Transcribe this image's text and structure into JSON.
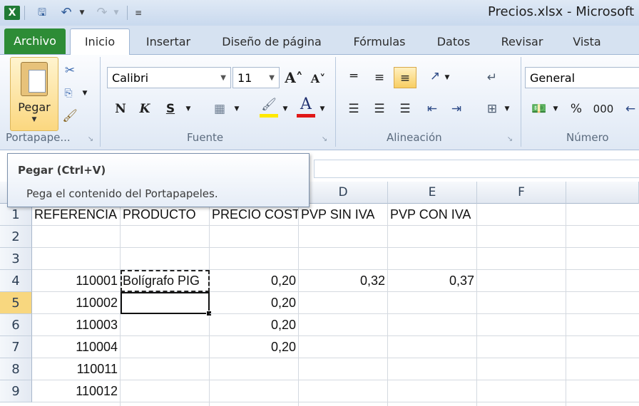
{
  "window": {
    "title": "Precios.xlsx - Microsoft E"
  },
  "tabs": [
    "Archivo",
    "Inicio",
    "Insertar",
    "Diseño de página",
    "Fórmulas",
    "Datos",
    "Revisar",
    "Vista"
  ],
  "ribbon": {
    "paste_label": "Pegar",
    "font_name": "Calibri",
    "font_size": "11",
    "bold": "N",
    "italic": "K",
    "underline": "S",
    "number_format": "General",
    "percent": "%",
    "thousands": "000",
    "groups": {
      "clipboard": "Portapape...",
      "font": "Fuente",
      "alignment": "Alineación",
      "number": "Número"
    }
  },
  "tooltip": {
    "title": "Pegar (Ctrl+V)",
    "body": "Pega el contenido del Portapapeles."
  },
  "columns": [
    "D",
    "E",
    "F"
  ],
  "rows": [
    "1",
    "2",
    "3",
    "4",
    "5",
    "6",
    "7",
    "8",
    "9"
  ],
  "cells": {
    "r1": [
      "REFERENCIA",
      "PRODUCTO",
      "PRECIO COSTE",
      "PVP SIN IVA",
      "PVP CON IVA"
    ],
    "r4": [
      "110001",
      "Bolígrafo PIG",
      "0,20",
      "0,32",
      "0,37"
    ],
    "r5": [
      "110002",
      "0,20"
    ],
    "r6": [
      "110003",
      "0,20"
    ],
    "r7": [
      "110004",
      "0,20"
    ],
    "r8": [
      "110011"
    ],
    "r9": [
      "110012"
    ]
  }
}
